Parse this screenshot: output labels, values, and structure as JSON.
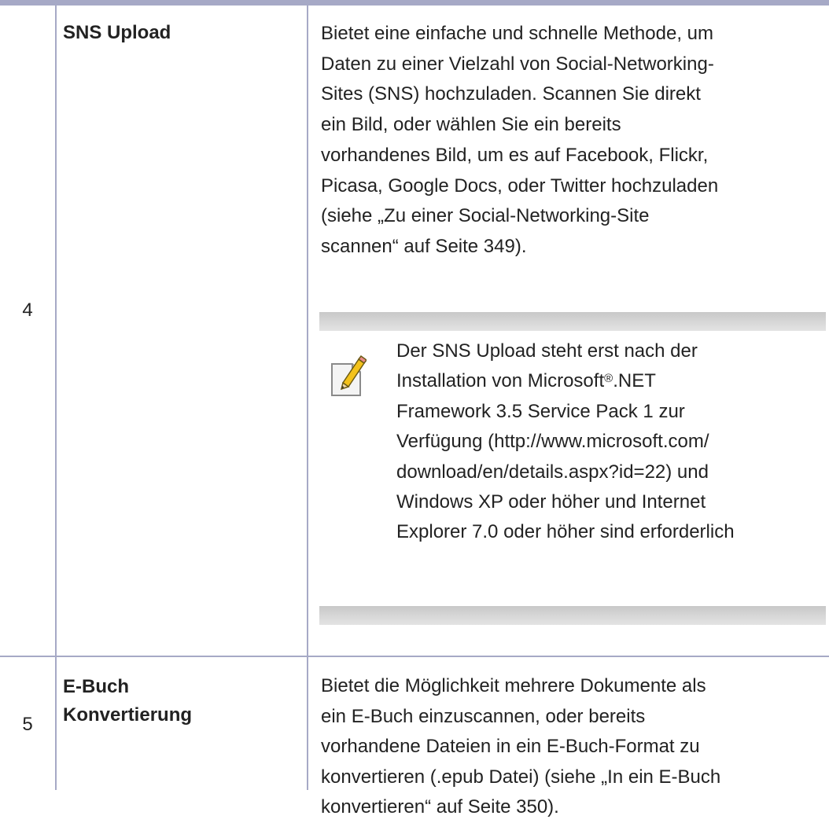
{
  "rows": [
    {
      "number": "4",
      "name_lines": [
        "SNS Upload"
      ],
      "description_lines": [
        "Bietet eine einfache und schnelle Methode, um",
        "Daten zu einer Vielzahl von Social-Networking-",
        "Sites (SNS) hochzuladen. Scannen Sie direkt",
        "ein Bild, oder wählen Sie ein bereits",
        "vorhandenes Bild, um es auf Facebook, Flickr,",
        "Picasa, Google Docs, oder Twitter hochzuladen",
        "(siehe „Zu einer Social-Networking-Site",
        "scannen“ auf Seite 349)."
      ],
      "note": {
        "icon": "note-pencil-icon",
        "line1": "Der SNS Upload steht erst nach der",
        "line2_before": "Installation von Microsoft",
        "registered_mark": "®",
        "line2_after": ".NET",
        "lines_rest": [
          "Framework 3.5 Service Pack 1 zur",
          "Verfügung (http://www.microsoft.com/",
          "download/en/details.aspx?id=22) und",
          "Windows XP oder höher und Internet",
          "Explorer 7.0 oder höher sind erforderlich"
        ]
      }
    },
    {
      "number": "5",
      "name_lines": [
        "E-Buch",
        "Konvertierung"
      ],
      "description_lines": [
        "Bietet die Möglichkeit mehrere Dokumente als",
        "ein E-Buch einzuscannen, oder bereits",
        "vorhandene Dateien in ein E-Buch-Format zu",
        "konvertieren (.epub Datei) (siehe „In ein E-Buch",
        "konvertieren“ auf Seite 350)."
      ]
    }
  ],
  "colors": {
    "rule": "#a6a9c6",
    "text": "#222222",
    "note_bar_dark": "#c8c8c8",
    "note_bar_light": "#e4e4e4"
  }
}
